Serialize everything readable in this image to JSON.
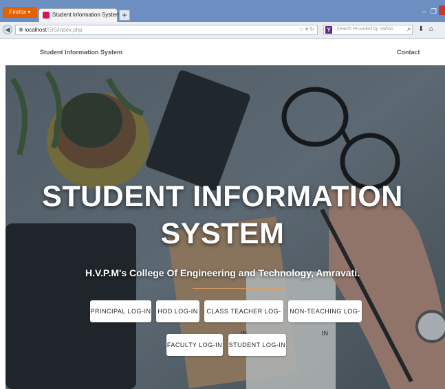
{
  "browser": {
    "app_button": "Firefox ▾",
    "tab_title": "Student Information System",
    "new_tab": "+",
    "url_host": "localhost",
    "url_path": "/SIS/index.php",
    "search_placeholder": "Search Provided by Yahoo",
    "minimize": "–",
    "restore": "❐"
  },
  "nav": {
    "brand": "Student Information System",
    "contact": "Contact"
  },
  "hero": {
    "title_line1": "STUDENT INFORMATION",
    "title_line2": "SYSTEM",
    "subtitle": "H.V.P.M's College Of Engineering and Technology, Amravati."
  },
  "buttons": {
    "principal": "PRINCIPAL LOG-IN",
    "hod": "HOD LOG-IN",
    "class_teacher": "CLASS TEACHER LOG-IN",
    "non_teaching": "NON-TEACHING LOG-IN",
    "faculty": "FACULTY LOG-IN",
    "student": "STUDENT LOG-IN"
  },
  "icons": {
    "back": "back-arrow-icon",
    "site": "globe-icon",
    "bookmark": "star-icon",
    "reload": "reload-icon",
    "search": "search-icon",
    "download": "download-icon",
    "home": "home-icon"
  }
}
